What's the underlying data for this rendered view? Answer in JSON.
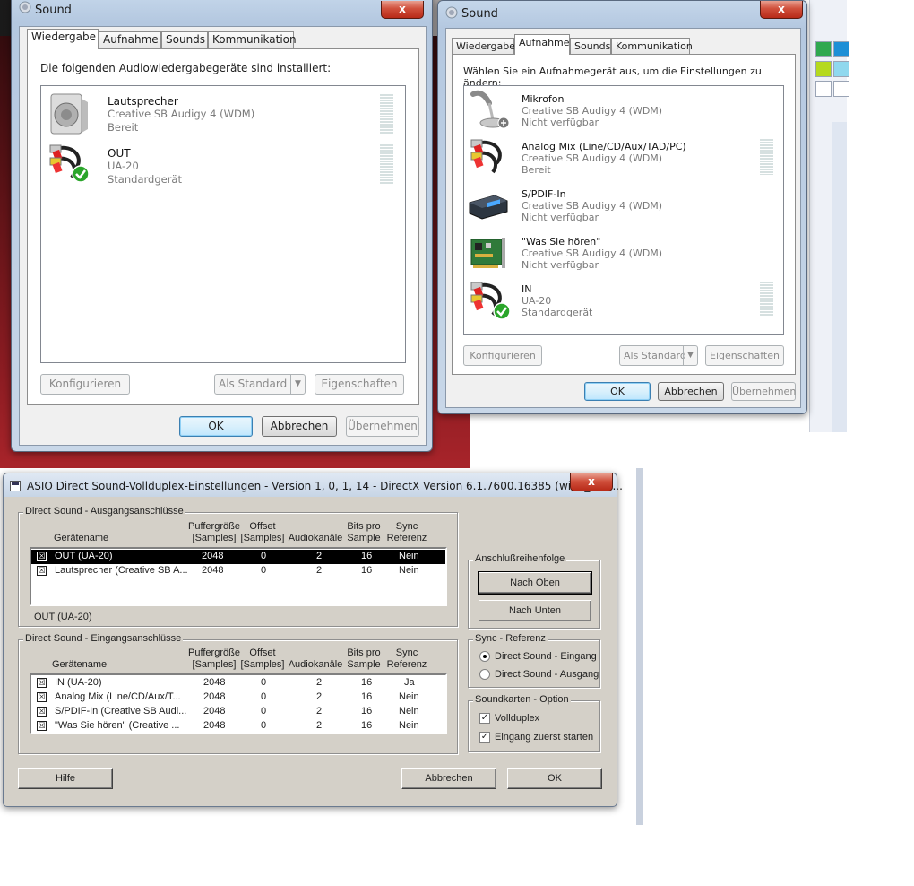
{
  "sound_playback": {
    "title": "Sound",
    "close": "x",
    "tabs": [
      "Wiedergabe",
      "Aufnahme",
      "Sounds",
      "Kommunikation"
    ],
    "instruction": "Die folgenden Audiowiedergabegeräte sind installiert:",
    "devices": [
      {
        "name": "Lautsprecher",
        "driver": "Creative SB Audigy 4 (WDM)",
        "status": "Bereit",
        "icon": "speaker-icon"
      },
      {
        "name": "OUT",
        "driver": "UA-20",
        "status": "Standardgerät",
        "icon": "rca-cable-default-icon"
      }
    ],
    "buttons": {
      "configure": "Konfigurieren",
      "set_default": "Als Standard",
      "properties": "Eigenschaften",
      "ok": "OK",
      "cancel": "Abbrechen",
      "apply": "Übernehmen"
    }
  },
  "sound_recording": {
    "title": "Sound",
    "close": "x",
    "tabs": [
      "Wiedergabe",
      "Aufnahme",
      "Sounds",
      "Kommunikation"
    ],
    "instruction": "Wählen Sie ein Aufnahmegerät aus, um die Einstellungen zu ändern:",
    "devices": [
      {
        "name": "Mikrofon",
        "driver": "Creative SB Audigy 4 (WDM)",
        "status": "Nicht verfügbar",
        "icon": "microphone-icon"
      },
      {
        "name": "Analog Mix (Line/CD/Aux/TAD/PC)",
        "driver": "Creative SB Audigy 4 (WDM)",
        "status": "Bereit",
        "icon": "rca-cable-icon"
      },
      {
        "name": "S/PDIF-In",
        "driver": "Creative SB Audigy 4 (WDM)",
        "status": "Nicht verfügbar",
        "icon": "spdif-device-icon"
      },
      {
        "name": "\"Was Sie hören\"",
        "driver": "Creative SB Audigy 4 (WDM)",
        "status": "Nicht verfügbar",
        "icon": "sound-card-icon"
      },
      {
        "name": "IN",
        "driver": "UA-20",
        "status": "Standardgerät",
        "icon": "rca-cable-default-icon"
      }
    ],
    "buttons": {
      "configure": "Konfigurieren",
      "set_default": "Als Standard",
      "properties": "Eigenschaften",
      "ok": "OK",
      "cancel": "Abbrechen",
      "apply": "Übernehmen"
    }
  },
  "asio": {
    "title": "ASIO Direct Sound-Vollduplex-Einstellungen   -  Version 1, 0, 1, 14   -  DirectX Version 6.1.7600.16385 (win7_rtm....",
    "close": "x",
    "output_group": "Direct Sound - Ausgangsanschlüsse",
    "input_group": "Direct Sound - Eingangsanschlüsse",
    "headers": {
      "device": "Gerätename",
      "buffer": "Puffergröße\n[Samples]",
      "offset": "Offset\n[Samples]",
      "channels": "Audiokanäle",
      "bits": "Bits pro\nSample",
      "sync": "Sync\nReferenz"
    },
    "outputs": [
      {
        "checked": "☒",
        "name": "OUT (UA-20)",
        "buffer": "2048",
        "offset": "0",
        "channels": "2",
        "bits": "16",
        "sync": "Nein"
      },
      {
        "checked": "☒",
        "name": "Lautsprecher (Creative SB A...",
        "buffer": "2048",
        "offset": "0",
        "channels": "2",
        "bits": "16",
        "sync": "Nein"
      }
    ],
    "selected_output": "OUT (UA-20)",
    "inputs": [
      {
        "checked": "☒",
        "name": "IN (UA-20)",
        "buffer": "2048",
        "offset": "0",
        "channels": "2",
        "bits": "16",
        "sync": "Ja"
      },
      {
        "checked": "☒",
        "name": "Analog Mix (Line/CD/Aux/T...",
        "buffer": "2048",
        "offset": "0",
        "channels": "2",
        "bits": "16",
        "sync": "Nein"
      },
      {
        "checked": "☒",
        "name": "S/PDIF-In (Creative SB Audi...",
        "buffer": "2048",
        "offset": "0",
        "channels": "2",
        "bits": "16",
        "sync": "Nein"
      },
      {
        "checked": "☒",
        "name": "\"Was Sie hören\" (Creative ...",
        "buffer": "2048",
        "offset": "0",
        "channels": "2",
        "bits": "16",
        "sync": "Nein"
      }
    ],
    "order_group": "Anschlußreihenfolge",
    "move_up": "Nach Oben",
    "move_down": "Nach Unten",
    "sync_group": "Sync - Referenz",
    "sync_input": "Direct Sound - Eingang",
    "sync_output": "Direct Sound - Ausgang",
    "card_group": "Soundkarten - Option",
    "fullduplex": "Vollduplex",
    "start_input_first": "Eingang zuerst starten",
    "check_mark": "✓",
    "help": "Hilfe",
    "cancel": "Abbrechen",
    "ok": "OK"
  },
  "colors": {
    "selection": "#000000",
    "win7_frame": "#b4c8e0",
    "classic_face": "#d4d0c8",
    "close_red": "#c8402c"
  }
}
